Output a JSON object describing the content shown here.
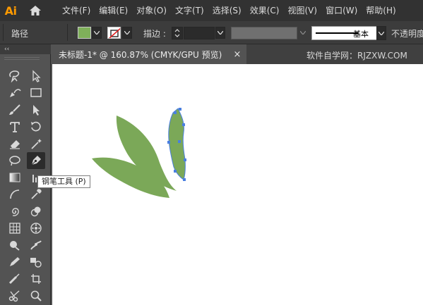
{
  "app": {
    "logo_text": "Ai",
    "accent_color": "#ff9a00"
  },
  "menu": {
    "items": [
      {
        "label": "文件(F)"
      },
      {
        "label": "编辑(E)"
      },
      {
        "label": "对象(O)"
      },
      {
        "label": "文字(T)"
      },
      {
        "label": "选择(S)"
      },
      {
        "label": "效果(C)"
      },
      {
        "label": "视图(V)"
      },
      {
        "label": "窗口(W)"
      },
      {
        "label": "帮助(H)"
      }
    ]
  },
  "control_bar": {
    "selection_type": "路径",
    "fill_color": "#7fb05a",
    "stroke_label": "描边 :",
    "stroke_weight": "",
    "profile_label": "基本",
    "opacity_label": "不透明度"
  },
  "document": {
    "tab_title": "未标题-1* @ 160.87% (CMYK/GPU 预览)",
    "close_glyph": "×",
    "watermark": "软件自学网：RJZXW.COM"
  },
  "toolbar": {
    "collapse_glyph": "‹‹",
    "active_tool": "pen-tool",
    "tooltip": "钢笔工具 (P)"
  },
  "artwork": {
    "leaf_color": "#7ba858",
    "anchor_color": "#4a7fe0"
  }
}
